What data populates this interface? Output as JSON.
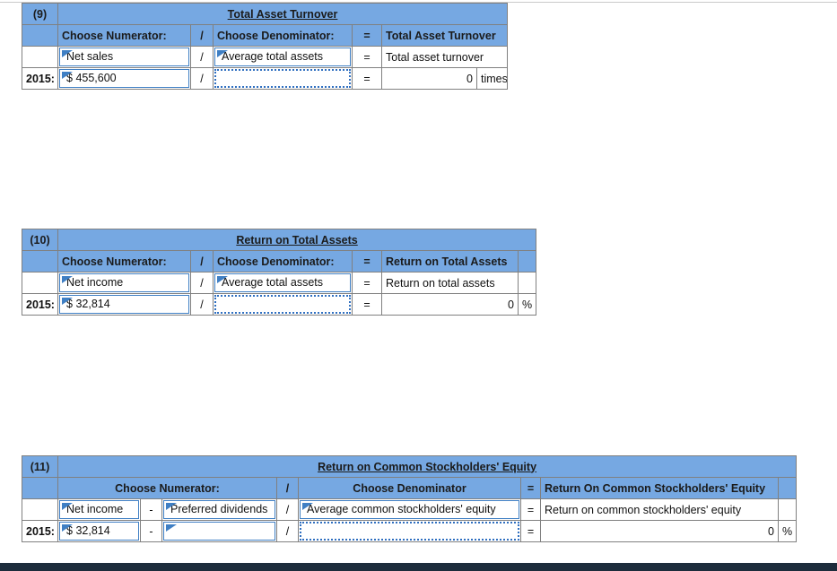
{
  "page": {
    "accent_blue": "#76a8e2",
    "input_border_blue": "#3f7fc4",
    "bottom_bar_color": "#1d2c3c"
  },
  "tables": [
    {
      "number": "(9)",
      "title": "Total Asset Turnover",
      "headers": {
        "numerator": "Choose Numerator:",
        "divider": "/",
        "denominator": "Choose Denominator:",
        "equals": "=",
        "result": "Total Asset Turnover",
        "unit": ""
      },
      "formula_row": {
        "year_label": "",
        "numerator": "Net sales",
        "divider": "/",
        "denominator": "Average total assets",
        "equals": "=",
        "result": "Total asset turnover",
        "unit": ""
      },
      "value_row": {
        "year_label": "2015:",
        "currency": "$",
        "numerator": "455,600",
        "divider": "/",
        "denominator": "",
        "equals": "=",
        "result": "0",
        "unit": "times"
      }
    },
    {
      "number": "(10)",
      "title": "Return on Total Assets",
      "headers": {
        "numerator": "Choose Numerator:",
        "divider": "/",
        "denominator": "Choose Denominator:",
        "equals": "=",
        "result": "Return on Total Assets",
        "unit": ""
      },
      "formula_row": {
        "year_label": "",
        "numerator": "Net income",
        "divider": "/",
        "denominator": "Average total assets",
        "equals": "=",
        "result": "Return on total assets",
        "unit": ""
      },
      "value_row": {
        "year_label": "2015:",
        "currency": "$",
        "numerator": "32,814",
        "divider": "/",
        "denominator": "",
        "equals": "=",
        "result": "0",
        "unit": "%"
      }
    },
    {
      "number": "(11)",
      "title": "Return on Common Stockholders' Equity",
      "headers": {
        "numerator": "Choose Numerator:",
        "minus": "",
        "divider": "/",
        "denominator": "Choose Denominator",
        "equals": "=",
        "result": "Return On Common Stockholders' Equity",
        "unit": ""
      },
      "formula_row": {
        "year_label": "",
        "numerator": "Net income",
        "minus": "-",
        "numerator2": "Preferred dividends",
        "divider": "/",
        "denominator": "Average common stockholders' equity",
        "equals": "=",
        "result": "Return on common stockholders' equity",
        "unit": ""
      },
      "value_row": {
        "year_label": "2015:",
        "currency": "$",
        "numerator": "32,814",
        "minus": "-",
        "numerator2": "",
        "divider": "/",
        "denominator": "",
        "equals": "=",
        "result": "0",
        "unit": "%"
      }
    }
  ]
}
